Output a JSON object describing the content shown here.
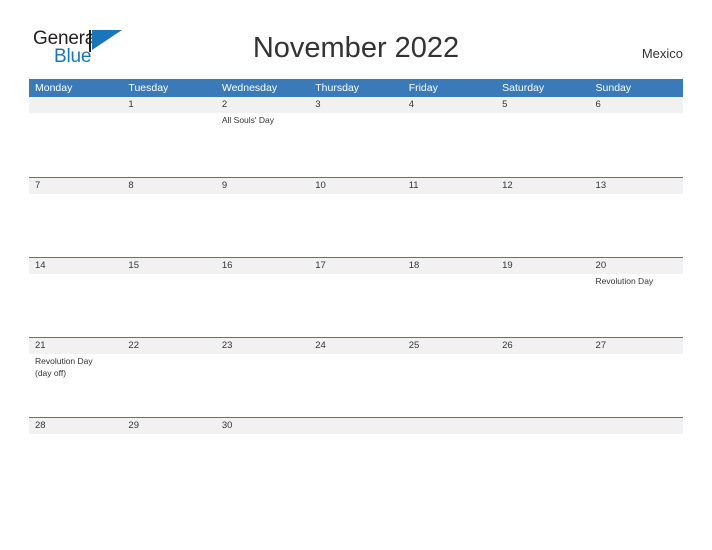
{
  "brand": {
    "name_top": "General",
    "name_bottom": "Blue"
  },
  "header": {
    "title": "November 2022",
    "country": "Mexico"
  },
  "calendar": {
    "weekdays": [
      "Monday",
      "Tuesday",
      "Wednesday",
      "Thursday",
      "Friday",
      "Saturday",
      "Sunday"
    ],
    "accent_color": "#3a7ab8",
    "band_color": "#f1f1f1",
    "weeks": [
      {
        "days": [
          {
            "num": "",
            "events": []
          },
          {
            "num": "1",
            "events": []
          },
          {
            "num": "2",
            "events": [
              "All Souls' Day"
            ]
          },
          {
            "num": "3",
            "events": []
          },
          {
            "num": "4",
            "events": []
          },
          {
            "num": "5",
            "events": []
          },
          {
            "num": "6",
            "events": []
          }
        ]
      },
      {
        "days": [
          {
            "num": "7",
            "events": []
          },
          {
            "num": "8",
            "events": []
          },
          {
            "num": "9",
            "events": []
          },
          {
            "num": "10",
            "events": []
          },
          {
            "num": "11",
            "events": []
          },
          {
            "num": "12",
            "events": []
          },
          {
            "num": "13",
            "events": []
          }
        ]
      },
      {
        "days": [
          {
            "num": "14",
            "events": []
          },
          {
            "num": "15",
            "events": []
          },
          {
            "num": "16",
            "events": []
          },
          {
            "num": "17",
            "events": []
          },
          {
            "num": "18",
            "events": []
          },
          {
            "num": "19",
            "events": []
          },
          {
            "num": "20",
            "events": [
              "Revolution Day"
            ]
          }
        ]
      },
      {
        "days": [
          {
            "num": "21",
            "events": [
              "Revolution Day",
              "(day off)"
            ]
          },
          {
            "num": "22",
            "events": []
          },
          {
            "num": "23",
            "events": []
          },
          {
            "num": "24",
            "events": []
          },
          {
            "num": "25",
            "events": []
          },
          {
            "num": "26",
            "events": []
          },
          {
            "num": "27",
            "events": []
          }
        ]
      },
      {
        "days": [
          {
            "num": "28",
            "events": []
          },
          {
            "num": "29",
            "events": []
          },
          {
            "num": "30",
            "events": []
          },
          {
            "num": "",
            "events": []
          },
          {
            "num": "",
            "events": []
          },
          {
            "num": "",
            "events": []
          },
          {
            "num": "",
            "events": []
          }
        ]
      }
    ]
  }
}
